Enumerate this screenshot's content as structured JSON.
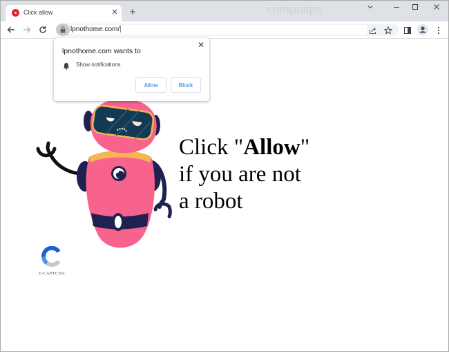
{
  "browser": {
    "tab": {
      "title": "Click allow",
      "favicon": "red-circle-icon"
    },
    "new_tab_label": "+",
    "watermark": "computips",
    "window_controls": {
      "dropdown": "⌄",
      "minimize": "–",
      "maximize": "☐",
      "close": "✕"
    },
    "nav": {
      "back": "←",
      "forward": "→",
      "reload": "↻"
    },
    "url": "lpnothome.com/",
    "icons": [
      "lock-icon",
      "share-icon",
      "star-icon",
      "side-panel-icon",
      "profile-icon",
      "menu-icon"
    ]
  },
  "permission_popup": {
    "title": "lpnothome.com wants to",
    "permission": "Show notifications",
    "allow_label": "Allow",
    "block_label": "Block",
    "close_label": "✕"
  },
  "page": {
    "headline": {
      "pre": "Click \"",
      "emphasis": "Allow",
      "post": "\"",
      "line2": "if you are not",
      "line3": "a robot"
    },
    "captcha_label": "E-CAPTCHA"
  },
  "colors": {
    "robot_pink": "#f7638c",
    "robot_navy": "#1f2150",
    "visor": "#123a52",
    "collar": "#f7b453",
    "link_blue": "#1a73e8"
  }
}
